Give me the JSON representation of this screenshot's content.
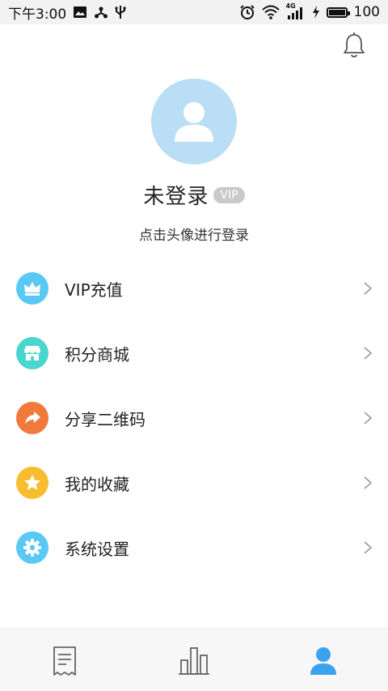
{
  "status_bar": {
    "time": "下午3:00",
    "battery_level": "100",
    "network": "4G",
    "icons": [
      "image-icon",
      "share-icon",
      "usb-icon",
      "alarm-icon",
      "wifi-icon",
      "signal-icon",
      "charging-icon",
      "battery-icon"
    ]
  },
  "header": {
    "bell_icon": "bell-icon"
  },
  "profile": {
    "name": "未登录",
    "vip_badge": "VIP",
    "hint": "点击头像进行登录",
    "avatar_color": "#b9def5"
  },
  "menu": {
    "items": [
      {
        "label": "VIP充值",
        "icon": "crown-icon",
        "color": "#5ac8f5"
      },
      {
        "label": "积分商城",
        "icon": "store-icon",
        "color": "#48d6cf"
      },
      {
        "label": "分享二维码",
        "icon": "share-arrow-icon",
        "color": "#f07a3c"
      },
      {
        "label": "我的收藏",
        "icon": "star-icon",
        "color": "#f7bd2e"
      },
      {
        "label": "系统设置",
        "icon": "gear-icon",
        "color": "#5ac8f5"
      }
    ]
  },
  "bottom_nav": {
    "tabs": [
      {
        "icon": "receipt-icon",
        "active": false
      },
      {
        "icon": "chart-bars-icon",
        "active": false
      },
      {
        "icon": "user-icon",
        "active": true
      }
    ],
    "active_color": "#3aa3f0"
  }
}
